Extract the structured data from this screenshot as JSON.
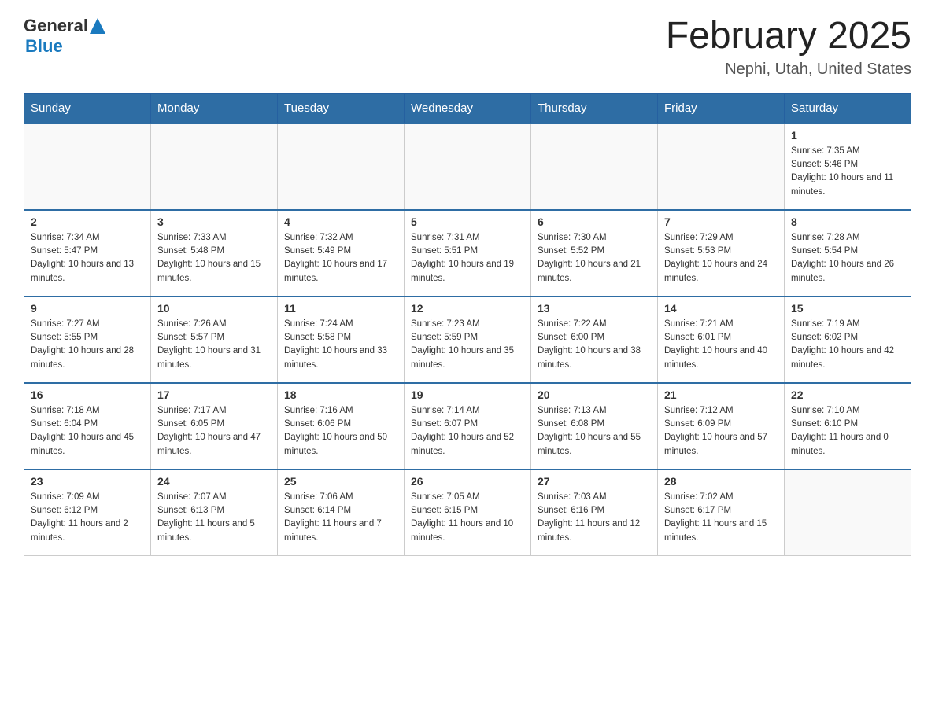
{
  "header": {
    "logo_general": "General",
    "logo_blue": "Blue",
    "title": "February 2025",
    "subtitle": "Nephi, Utah, United States"
  },
  "days_of_week": [
    "Sunday",
    "Monday",
    "Tuesday",
    "Wednesday",
    "Thursday",
    "Friday",
    "Saturday"
  ],
  "weeks": [
    [
      {
        "day": "",
        "sunrise": "",
        "sunset": "",
        "daylight": ""
      },
      {
        "day": "",
        "sunrise": "",
        "sunset": "",
        "daylight": ""
      },
      {
        "day": "",
        "sunrise": "",
        "sunset": "",
        "daylight": ""
      },
      {
        "day": "",
        "sunrise": "",
        "sunset": "",
        "daylight": ""
      },
      {
        "day": "",
        "sunrise": "",
        "sunset": "",
        "daylight": ""
      },
      {
        "day": "",
        "sunrise": "",
        "sunset": "",
        "daylight": ""
      },
      {
        "day": "1",
        "sunrise": "Sunrise: 7:35 AM",
        "sunset": "Sunset: 5:46 PM",
        "daylight": "Daylight: 10 hours and 11 minutes."
      }
    ],
    [
      {
        "day": "2",
        "sunrise": "Sunrise: 7:34 AM",
        "sunset": "Sunset: 5:47 PM",
        "daylight": "Daylight: 10 hours and 13 minutes."
      },
      {
        "day": "3",
        "sunrise": "Sunrise: 7:33 AM",
        "sunset": "Sunset: 5:48 PM",
        "daylight": "Daylight: 10 hours and 15 minutes."
      },
      {
        "day": "4",
        "sunrise": "Sunrise: 7:32 AM",
        "sunset": "Sunset: 5:49 PM",
        "daylight": "Daylight: 10 hours and 17 minutes."
      },
      {
        "day": "5",
        "sunrise": "Sunrise: 7:31 AM",
        "sunset": "Sunset: 5:51 PM",
        "daylight": "Daylight: 10 hours and 19 minutes."
      },
      {
        "day": "6",
        "sunrise": "Sunrise: 7:30 AM",
        "sunset": "Sunset: 5:52 PM",
        "daylight": "Daylight: 10 hours and 21 minutes."
      },
      {
        "day": "7",
        "sunrise": "Sunrise: 7:29 AM",
        "sunset": "Sunset: 5:53 PM",
        "daylight": "Daylight: 10 hours and 24 minutes."
      },
      {
        "day": "8",
        "sunrise": "Sunrise: 7:28 AM",
        "sunset": "Sunset: 5:54 PM",
        "daylight": "Daylight: 10 hours and 26 minutes."
      }
    ],
    [
      {
        "day": "9",
        "sunrise": "Sunrise: 7:27 AM",
        "sunset": "Sunset: 5:55 PM",
        "daylight": "Daylight: 10 hours and 28 minutes."
      },
      {
        "day": "10",
        "sunrise": "Sunrise: 7:26 AM",
        "sunset": "Sunset: 5:57 PM",
        "daylight": "Daylight: 10 hours and 31 minutes."
      },
      {
        "day": "11",
        "sunrise": "Sunrise: 7:24 AM",
        "sunset": "Sunset: 5:58 PM",
        "daylight": "Daylight: 10 hours and 33 minutes."
      },
      {
        "day": "12",
        "sunrise": "Sunrise: 7:23 AM",
        "sunset": "Sunset: 5:59 PM",
        "daylight": "Daylight: 10 hours and 35 minutes."
      },
      {
        "day": "13",
        "sunrise": "Sunrise: 7:22 AM",
        "sunset": "Sunset: 6:00 PM",
        "daylight": "Daylight: 10 hours and 38 minutes."
      },
      {
        "day": "14",
        "sunrise": "Sunrise: 7:21 AM",
        "sunset": "Sunset: 6:01 PM",
        "daylight": "Daylight: 10 hours and 40 minutes."
      },
      {
        "day": "15",
        "sunrise": "Sunrise: 7:19 AM",
        "sunset": "Sunset: 6:02 PM",
        "daylight": "Daylight: 10 hours and 42 minutes."
      }
    ],
    [
      {
        "day": "16",
        "sunrise": "Sunrise: 7:18 AM",
        "sunset": "Sunset: 6:04 PM",
        "daylight": "Daylight: 10 hours and 45 minutes."
      },
      {
        "day": "17",
        "sunrise": "Sunrise: 7:17 AM",
        "sunset": "Sunset: 6:05 PM",
        "daylight": "Daylight: 10 hours and 47 minutes."
      },
      {
        "day": "18",
        "sunrise": "Sunrise: 7:16 AM",
        "sunset": "Sunset: 6:06 PM",
        "daylight": "Daylight: 10 hours and 50 minutes."
      },
      {
        "day": "19",
        "sunrise": "Sunrise: 7:14 AM",
        "sunset": "Sunset: 6:07 PM",
        "daylight": "Daylight: 10 hours and 52 minutes."
      },
      {
        "day": "20",
        "sunrise": "Sunrise: 7:13 AM",
        "sunset": "Sunset: 6:08 PM",
        "daylight": "Daylight: 10 hours and 55 minutes."
      },
      {
        "day": "21",
        "sunrise": "Sunrise: 7:12 AM",
        "sunset": "Sunset: 6:09 PM",
        "daylight": "Daylight: 10 hours and 57 minutes."
      },
      {
        "day": "22",
        "sunrise": "Sunrise: 7:10 AM",
        "sunset": "Sunset: 6:10 PM",
        "daylight": "Daylight: 11 hours and 0 minutes."
      }
    ],
    [
      {
        "day": "23",
        "sunrise": "Sunrise: 7:09 AM",
        "sunset": "Sunset: 6:12 PM",
        "daylight": "Daylight: 11 hours and 2 minutes."
      },
      {
        "day": "24",
        "sunrise": "Sunrise: 7:07 AM",
        "sunset": "Sunset: 6:13 PM",
        "daylight": "Daylight: 11 hours and 5 minutes."
      },
      {
        "day": "25",
        "sunrise": "Sunrise: 7:06 AM",
        "sunset": "Sunset: 6:14 PM",
        "daylight": "Daylight: 11 hours and 7 minutes."
      },
      {
        "day": "26",
        "sunrise": "Sunrise: 7:05 AM",
        "sunset": "Sunset: 6:15 PM",
        "daylight": "Daylight: 11 hours and 10 minutes."
      },
      {
        "day": "27",
        "sunrise": "Sunrise: 7:03 AM",
        "sunset": "Sunset: 6:16 PM",
        "daylight": "Daylight: 11 hours and 12 minutes."
      },
      {
        "day": "28",
        "sunrise": "Sunrise: 7:02 AM",
        "sunset": "Sunset: 6:17 PM",
        "daylight": "Daylight: 11 hours and 15 minutes."
      },
      {
        "day": "",
        "sunrise": "",
        "sunset": "",
        "daylight": ""
      }
    ]
  ]
}
